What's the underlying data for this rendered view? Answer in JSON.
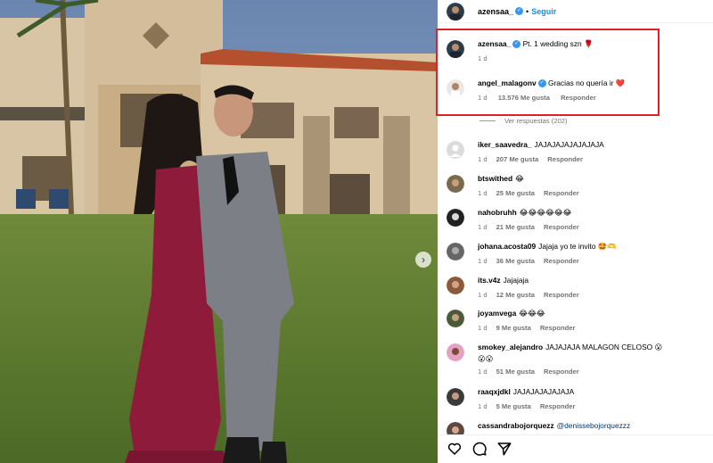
{
  "post_author": {
    "username": "azensaa_",
    "follow_label": "Seguir",
    "separator": "•"
  },
  "highlighted_comments": [
    {
      "username": "azensaa_",
      "text": "Pt. 1 wedding szn 🌹",
      "time": "1 d",
      "verified": true
    },
    {
      "username": "angel_malagonv",
      "text": "Gracias no quería ir ❤️",
      "time": "1 d",
      "likes": "13.576 Me gusta",
      "reply_label": "Responder",
      "verified": true
    }
  ],
  "view_replies_label": "Ver respuestas (202)",
  "comments": [
    {
      "username": "iker_saavedra_",
      "text": "JAJAJAJAJAJAJAJA",
      "time": "1 d",
      "likes": "207 Me gusta",
      "reply_label": "Responder"
    },
    {
      "username": "btswithed",
      "text": "😂",
      "time": "1 d",
      "likes": "25 Me gusta",
      "reply_label": "Responder"
    },
    {
      "username": "nahobruhh",
      "text": "😂😂😂😂😂😂",
      "time": "1 d",
      "likes": "21 Me gusta",
      "reply_label": "Responder"
    },
    {
      "username": "johana.acosta09",
      "text": "Jajaja yo te invito 🤩🫶",
      "time": "1 d",
      "likes": "36 Me gusta",
      "reply_label": "Responder"
    },
    {
      "username": "its.v4z",
      "text": "Jajajaja",
      "time": "1 d",
      "likes": "12 Me gusta",
      "reply_label": "Responder"
    },
    {
      "username": "joyamvega",
      "text": "😂😂😂",
      "time": "1 d",
      "likes": "9 Me gusta",
      "reply_label": "Responder"
    },
    {
      "username": "smokey_alejandro",
      "text": "JAJAJAJA MALAGON CELOSO 😮",
      "text2": "😮😮",
      "time": "1 d",
      "likes": "51 Me gusta",
      "reply_label": "Responder"
    },
    {
      "username": "raaqxjdkl",
      "text": "JAJAJAJAJAJAJA",
      "time": "1 d",
      "likes": "5 Me gusta",
      "reply_label": "Responder"
    },
    {
      "username": "cassandrabojorquezz",
      "text": "@denissebojorquezzz",
      "time": "",
      "likes": "",
      "reply_label": ""
    }
  ],
  "actions": {
    "like_icon": "heart-icon",
    "comment_icon": "comment-icon",
    "share_icon": "share-icon"
  },
  "carousel": {
    "next_icon": "chevron-right-icon",
    "next_glyph": "›"
  },
  "colors": {
    "accent": "#0095f6",
    "verified": "#3797f0",
    "highlight_box": "#e0202a",
    "dress": "#8e1b3a",
    "suit": "#7d7f86"
  }
}
